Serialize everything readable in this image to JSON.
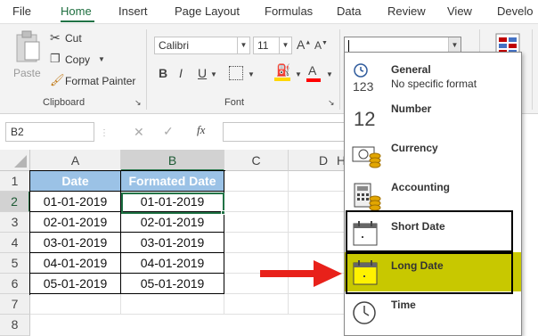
{
  "tabs": [
    "File",
    "Home",
    "Insert",
    "Page Layout",
    "Formulas",
    "Data",
    "Review",
    "View",
    "Develo"
  ],
  "clipboard": {
    "paste_label": "Paste",
    "cut_label": "Cut",
    "copy_label": "Copy",
    "format_painter_label": "Format Painter",
    "group_label": "Clipboard"
  },
  "font": {
    "name": "Calibri",
    "size": "11",
    "group_label": "Font",
    "bold_label": "B",
    "italic_label": "I",
    "underline_label": "U"
  },
  "number_format_value": "",
  "formula_bar": {
    "name_box": "B2",
    "fx_label": "fx",
    "formula_value": ""
  },
  "grid": {
    "columns": [
      "A",
      "B",
      "C",
      "D"
    ],
    "col_h_partial": "H",
    "rows": [
      "1",
      "2",
      "3",
      "4",
      "5",
      "6",
      "7",
      "8"
    ],
    "header_row": [
      "Date",
      "Formated Date"
    ],
    "data_rows": [
      [
        "01-01-2019",
        "01-01-2019"
      ],
      [
        "02-01-2019",
        "02-01-2019"
      ],
      [
        "03-01-2019",
        "03-01-2019"
      ],
      [
        "04-01-2019",
        "04-01-2019"
      ],
      [
        "05-01-2019",
        "05-01-2019"
      ]
    ],
    "header_fill": "#9bc2e6",
    "selection_color": "#217346"
  },
  "dropdown": {
    "items": [
      {
        "label": "General",
        "sub": "No specific format",
        "icon": "123"
      },
      {
        "label": "Number",
        "sub": "",
        "icon": "12"
      },
      {
        "label": "Currency",
        "sub": "",
        "icon": "currency-icon"
      },
      {
        "label": "Accounting",
        "sub": "",
        "icon": "accounting-icon"
      },
      {
        "label": "Short Date",
        "sub": "",
        "icon": "short-date-icon"
      },
      {
        "label": "Long Date",
        "sub": "",
        "icon": "long-date-icon"
      },
      {
        "label": "Time",
        "sub": "",
        "icon": "clock-icon"
      }
    ],
    "highlight_color": "#c8c800"
  },
  "arrow_color": "#e8211a"
}
